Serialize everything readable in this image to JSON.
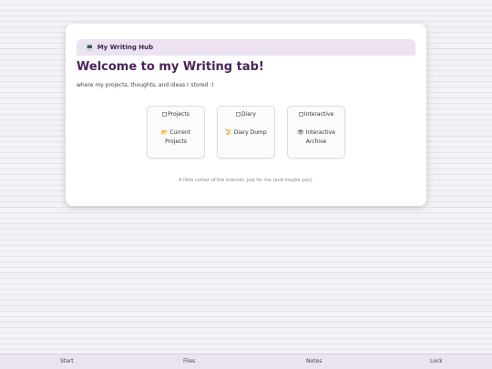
{
  "window": {
    "title_icon": "laptop-icon",
    "title_emoji": "💻",
    "title": "My Writing Hub",
    "heading": "Welcome to my Writing tab!",
    "subtitle": "where my projects, thoughts, and ideas r stored :)",
    "cards": [
      {
        "img_alt": "Projects",
        "emoji": "📂",
        "label": "Current Projects"
      },
      {
        "img_alt": "Diary",
        "emoji": "📜",
        "label": "Diary Dump"
      },
      {
        "img_alt": "Interactive",
        "emoji": "👁",
        "label": "Interactive Archive"
      }
    ],
    "footer": "A little corner of the internet, just for me (and maybe you)."
  },
  "taskbar": {
    "items": [
      "Start",
      "Files",
      "Notes",
      "Lock"
    ]
  },
  "colors": {
    "background": "#f4f2f6",
    "stripe": "#e6e2ea",
    "titlebar": "#ece2f2",
    "heading": "#4a2458",
    "taskbar": "#ebe4f0"
  }
}
